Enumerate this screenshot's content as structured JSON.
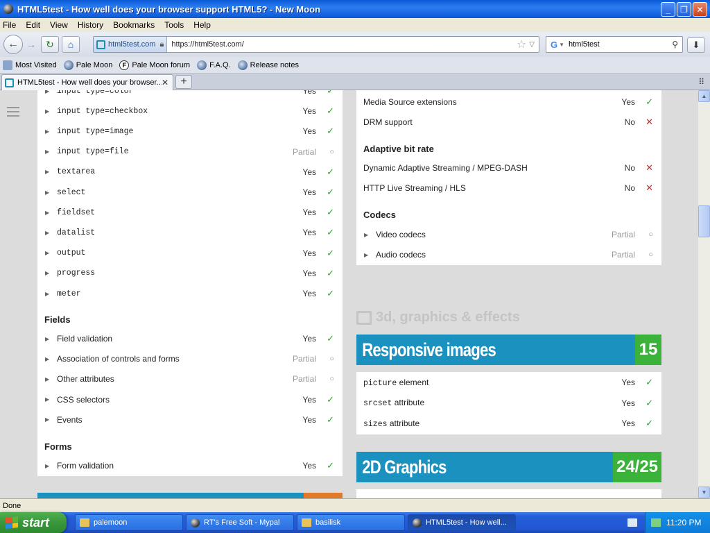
{
  "window": {
    "title": "HTML5test - How well does your browser support HTML5? - New Moon",
    "min_label": "_",
    "max_label": "❐",
    "close_label": "✕"
  },
  "menu": [
    "File",
    "Edit",
    "View",
    "History",
    "Bookmarks",
    "Tools",
    "Help"
  ],
  "nav": {
    "back_glyph": "←",
    "forward_glyph": "→",
    "reload_glyph": "↻",
    "home_glyph": "⌂",
    "site_identity": "html5test.com",
    "url": "https://html5test.com/",
    "search_value": "html5test"
  },
  "bookmarks": [
    "Most Visited",
    "Pale Moon",
    "Pale Moon forum",
    "F.A.Q.",
    "Release notes"
  ],
  "tab": {
    "title": "HTML5test - How well does your browser...",
    "close_glyph": "✕",
    "new_tab_glyph": "+"
  },
  "left_panel": {
    "rows": [
      {
        "name": "input type=color",
        "result": "Yes",
        "status": "yes",
        "mono": true
      },
      {
        "name": "input type=checkbox",
        "result": "Yes",
        "status": "yes",
        "mono": true
      },
      {
        "name": "input type=image",
        "result": "Yes",
        "status": "yes",
        "mono": true
      },
      {
        "name": "input type=file",
        "result": "Partial",
        "status": "partial",
        "mono": true
      },
      {
        "name": "textarea",
        "result": "Yes",
        "status": "yes",
        "mono": true
      },
      {
        "name": "select",
        "result": "Yes",
        "status": "yes",
        "mono": true
      },
      {
        "name": "fieldset",
        "result": "Yes",
        "status": "yes",
        "mono": true
      },
      {
        "name": "datalist",
        "result": "Yes",
        "status": "yes",
        "mono": true
      },
      {
        "name": "output",
        "result": "Yes",
        "status": "yes",
        "mono": true
      },
      {
        "name": "progress",
        "result": "Yes",
        "status": "yes",
        "mono": true
      },
      {
        "name": "meter",
        "result": "Yes",
        "status": "yes",
        "mono": true
      }
    ],
    "fields_heading": "Fields",
    "fields_rows": [
      {
        "name": "Field validation",
        "result": "Yes",
        "status": "yes"
      },
      {
        "name": "Association of controls and forms",
        "result": "Partial",
        "status": "partial"
      },
      {
        "name": "Other attributes",
        "result": "Partial",
        "status": "partial"
      },
      {
        "name": "CSS selectors",
        "result": "Yes",
        "status": "yes"
      },
      {
        "name": "Events",
        "result": "Yes",
        "status": "yes"
      }
    ],
    "forms_heading": "Forms",
    "forms_rows": [
      {
        "name": "Form validation",
        "result": "Yes",
        "status": "yes"
      }
    ]
  },
  "right_panel": {
    "rows_top": [
      {
        "name": "Media Source extensions",
        "result": "Yes",
        "status": "yes"
      },
      {
        "name": "DRM support",
        "result": "No",
        "status": "no"
      }
    ],
    "abr_heading": "Adaptive bit rate",
    "abr_rows": [
      {
        "name": "Dynamic Adaptive Streaming / MPEG-DASH",
        "result": "No",
        "status": "no"
      },
      {
        "name": "HTTP Live Streaming / HLS",
        "result": "No",
        "status": "no"
      }
    ],
    "codecs_heading": "Codecs",
    "codecs_rows": [
      {
        "name": "Video codecs",
        "result": "Partial",
        "status": "partial"
      },
      {
        "name": "Audio codecs",
        "result": "Partial",
        "status": "partial"
      }
    ]
  },
  "section_title": "3d, graphics & effects",
  "responsive": {
    "title": "Responsive images",
    "score": "15",
    "rows": [
      {
        "name": "picture",
        "suffix": " element",
        "result": "Yes",
        "status": "yes"
      },
      {
        "name": "srcset",
        "suffix": " attribute",
        "result": "Yes",
        "status": "yes"
      },
      {
        "name": "sizes",
        "suffix": " attribute",
        "result": "Yes",
        "status": "yes"
      }
    ]
  },
  "graphics2d": {
    "title": "2D Graphics",
    "score": "24/25"
  },
  "marks": {
    "yes": "✓",
    "no": "✕",
    "partial": "○"
  },
  "status_text": "Done",
  "taskbar": {
    "start_label": "start",
    "tasks": [
      {
        "label": "palemoon",
        "icon": "folder"
      },
      {
        "label": "RT's Free Soft - Mypal",
        "icon": "browser"
      },
      {
        "label": "basilisk",
        "icon": "folder"
      },
      {
        "label": "HTML5test - How well...",
        "icon": "browser"
      }
    ],
    "clock": "11:20 PM"
  },
  "colors": {
    "banner_blue": "#1b91c0",
    "score_green": "#3bb33b",
    "yes_green": "#2aa52a",
    "no_red": "#cc2a2a"
  }
}
